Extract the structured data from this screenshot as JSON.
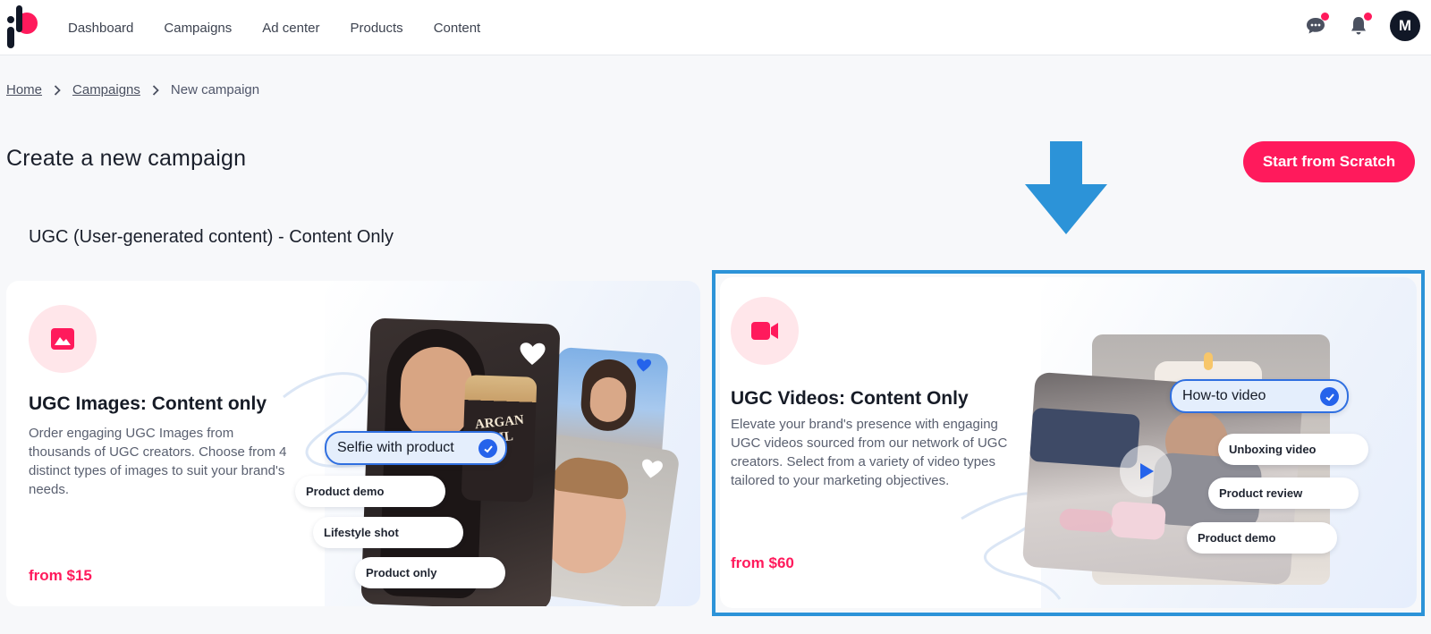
{
  "nav": {
    "items": [
      "Dashboard",
      "Campaigns",
      "Ad center",
      "Products",
      "Content"
    ]
  },
  "header": {
    "avatar_initial": "M"
  },
  "breadcrumb": {
    "home": "Home",
    "campaigns": "Campaigns",
    "current": "New campaign"
  },
  "page": {
    "title": "Create a new campaign",
    "scratch_button": "Start from Scratch",
    "section_title": "UGC (User-generated content) - Content Only"
  },
  "cards": {
    "images": {
      "title": "UGC Images: Content only",
      "description": "Order engaging UGC Images from thousands of UGC creators. Choose from 4 distinct types of images to suit your brand's needs.",
      "price": "from $15",
      "product_label": "ARGAN OIL",
      "chips": {
        "selected": "Selfie with product",
        "options": [
          "Product demo",
          "Lifestyle shot",
          "Product only"
        ]
      }
    },
    "videos": {
      "title": "UGC Videos: Content Only",
      "description": "Elevate your brand's presence with engaging UGC videos sourced from our network of UGC creators. Select from a variety of video types tailored to your marketing objectives.",
      "price": "from $60",
      "chips": {
        "selected": "How-to video",
        "options": [
          "Unboxing video",
          "Product review",
          "Product demo"
        ]
      }
    }
  },
  "colors": {
    "accent": "#ff1a5c",
    "highlight_border": "#2c93d8",
    "check_blue": "#2563eb"
  }
}
